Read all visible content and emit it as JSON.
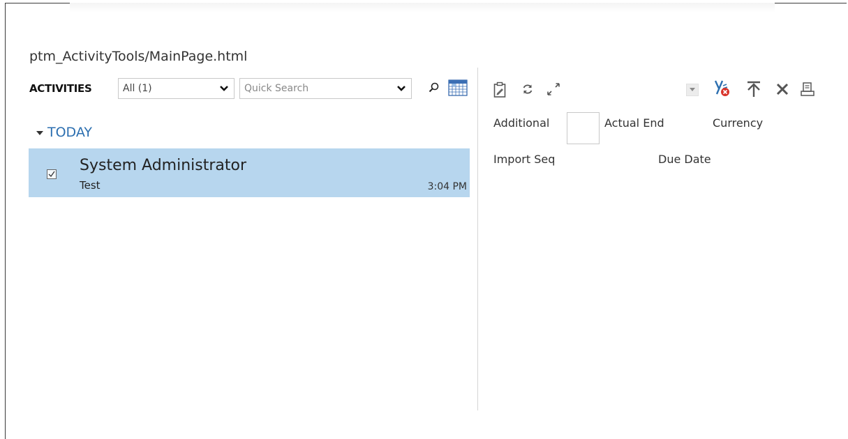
{
  "webresource": {
    "title": "ptm_ActivityTools/MainPage.html"
  },
  "activities": {
    "header_label": "ACTIVITIES",
    "filter": {
      "value": "All (1)"
    },
    "search": {
      "placeholder": "Quick Search"
    },
    "section": "TODAY",
    "items": [
      {
        "name": "System Administrator",
        "subject": "Test",
        "time": "3:04 PM",
        "checked": true
      }
    ]
  },
  "detail": {
    "fields": {
      "additional": "Additional",
      "actual_end": "Actual End",
      "currency": "Currency",
      "import_seq": "Import Seq",
      "due_date": "Due Date"
    }
  },
  "icons": {
    "toolbar_left": [
      "clipboard-edit-icon",
      "refresh-icon",
      "expand-icon"
    ],
    "toolbar_right": [
      "dropdown-icon",
      "filter-remove-icon",
      "move-up-icon",
      "delete-icon",
      "print-icon"
    ],
    "list_toolbar": [
      "search-icon",
      "calendar-icon"
    ]
  },
  "colors": {
    "selection": "#b7d6ee",
    "accent": "#2c6fb0"
  }
}
